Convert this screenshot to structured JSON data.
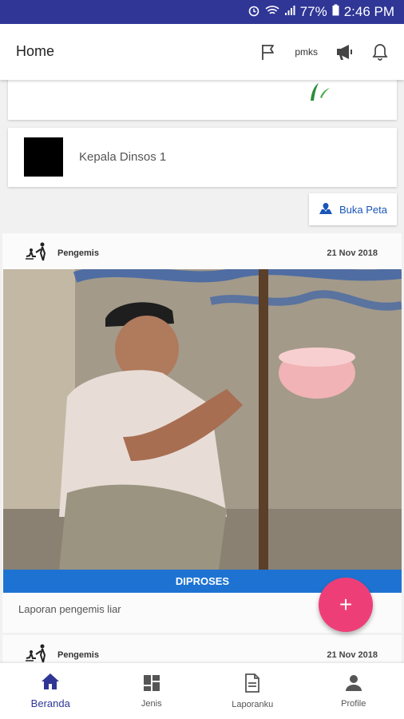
{
  "status_bar": {
    "battery": "77%",
    "time": "2:46 PM"
  },
  "appbar": {
    "title": "Home",
    "actions": [
      {
        "icon": "flag-icon"
      },
      {
        "label": "pmks"
      },
      {
        "icon": "megaphone-icon"
      },
      {
        "icon": "bell-icon"
      }
    ]
  },
  "user_card": {
    "name": "Kepala Dinsos 1"
  },
  "map_button": {
    "label": "Buka Peta",
    "icon": "map-marker-icon"
  },
  "posts": [
    {
      "category": "Pengemis",
      "date": "21 Nov 2018",
      "status": "DIPROSES",
      "description": "Laporan pengemis liar"
    },
    {
      "category": "Pengemis",
      "date": "21 Nov 2018"
    }
  ],
  "fab": {
    "label": "+"
  },
  "bottom_nav": [
    {
      "label": "Beranda",
      "icon": "home-icon",
      "active": true
    },
    {
      "label": "Jenis",
      "icon": "dashboard-icon",
      "active": false
    },
    {
      "label": "Laporanku",
      "icon": "document-icon",
      "active": false
    },
    {
      "label": "Profile",
      "icon": "person-icon",
      "active": false
    }
  ],
  "colors": {
    "primary": "#2f3696",
    "status_blue": "#1e73d2",
    "fab": "#ee3e78",
    "link": "#1a56b8"
  }
}
